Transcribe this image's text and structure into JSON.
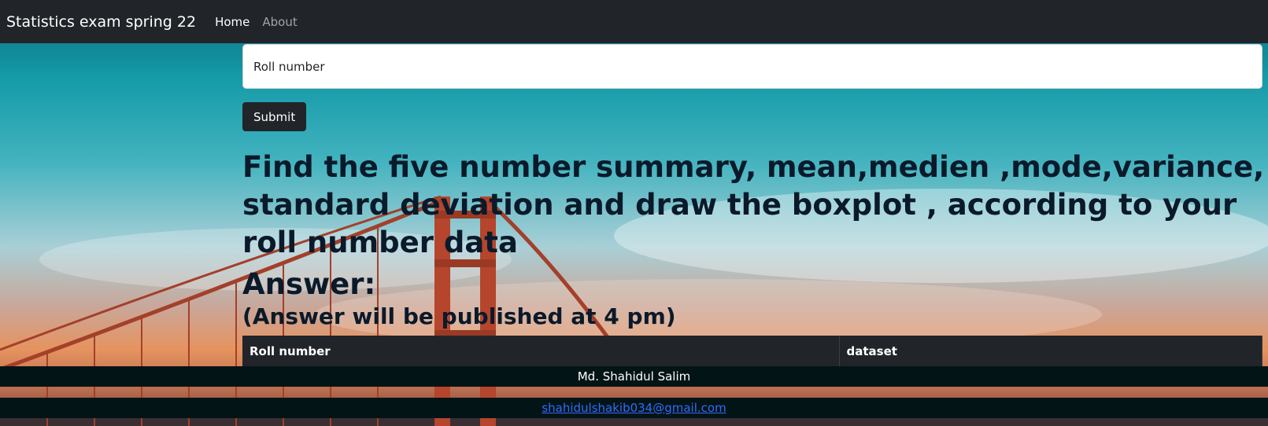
{
  "navbar": {
    "brand": "Statistics exam spring 22",
    "links": [
      {
        "label": "Home"
      },
      {
        "label": "About"
      }
    ]
  },
  "form": {
    "roll_placeholder": "Roll number",
    "submit_label": "Submit"
  },
  "question": "Find the five number summary, mean,medien ,mode,variance, standard deviation and draw the boxplot , according to your roll number data",
  "answer": {
    "title": "Answer:",
    "note": "(Answer will be published at 4 pm)"
  },
  "table": {
    "headers": [
      "Roll number",
      "dataset"
    ]
  },
  "footer": {
    "name": "Md. Shahidul Salim",
    "email": "shahidulshakib034@gmail.com"
  },
  "colors": {
    "navbar": "#212529",
    "footer": "#031416",
    "link": "#2f6cff"
  }
}
